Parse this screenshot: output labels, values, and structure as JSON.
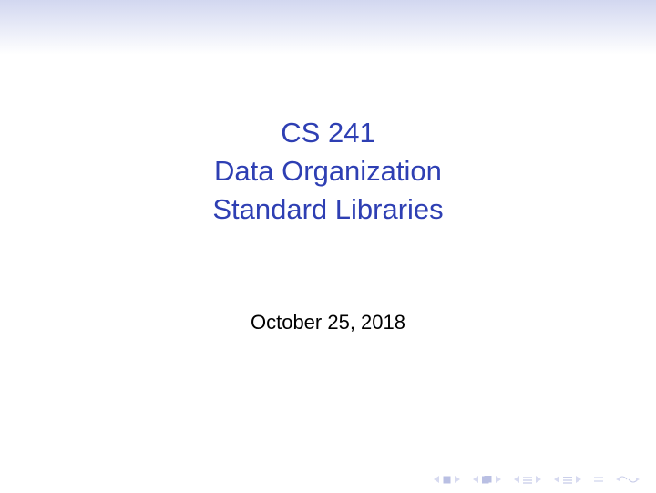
{
  "title": {
    "line1": "CS 241",
    "line2": "Data Organization",
    "line3": "Standard Libraries"
  },
  "date": "October 25, 2018"
}
